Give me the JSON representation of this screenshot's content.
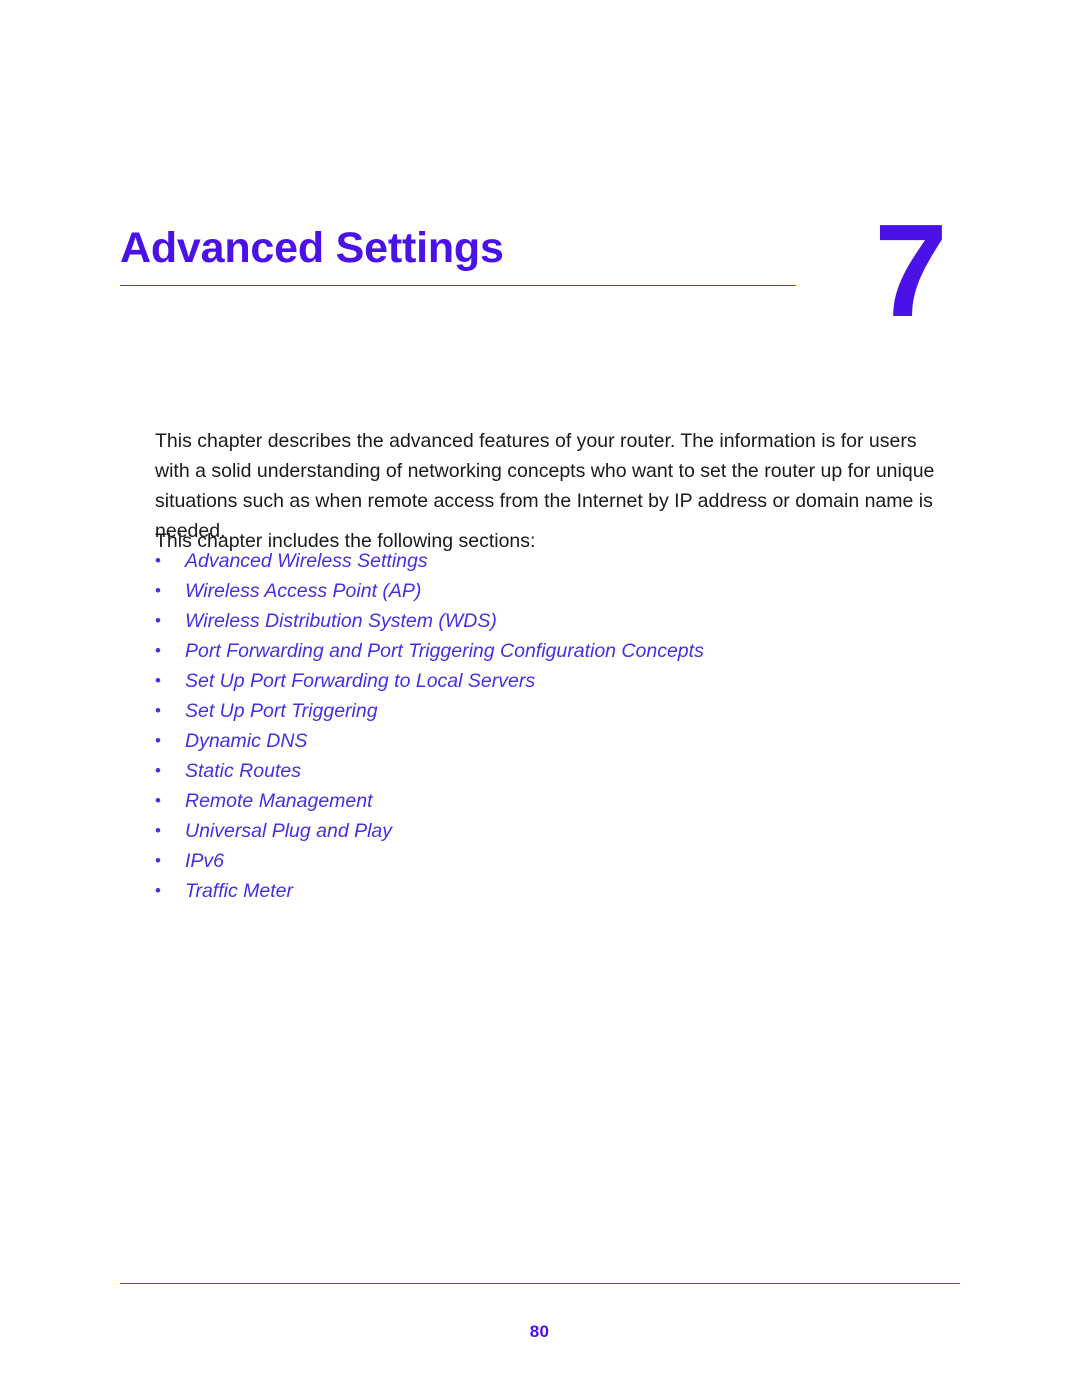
{
  "document": {
    "page_number": "80",
    "accent_color": "#4B12E8",
    "link_color": "#4330E6",
    "rule_color": "#6A30E0"
  },
  "chapter": {
    "title": "Advanced Settings",
    "number": "7"
  },
  "body": {
    "intro_paragraph": "This chapter describes the advanced features of your router. The information is for users with a solid understanding of networking concepts who want to set the router up for unique situations such as when remote access from the Internet by IP address or domain name is needed.",
    "intro_lead": "This chapter includes the following sections:"
  },
  "section_list": {
    "bullet_glyph": "•",
    "items": [
      {
        "label": "Advanced Wireless Settings"
      },
      {
        "label": "Wireless Access Point (AP)"
      },
      {
        "label": "Wireless Distribution System (WDS)"
      },
      {
        "label": "Port Forwarding and Port Triggering Configuration Concepts"
      },
      {
        "label": "Set Up Port Forwarding to Local Servers"
      },
      {
        "label": "Set Up Port Triggering"
      },
      {
        "label": "Dynamic DNS"
      },
      {
        "label": "Static Routes"
      },
      {
        "label": "Remote Management"
      },
      {
        "label": "Universal Plug and Play"
      },
      {
        "label": "IPv6"
      },
      {
        "label": "Traffic Meter"
      }
    ]
  }
}
